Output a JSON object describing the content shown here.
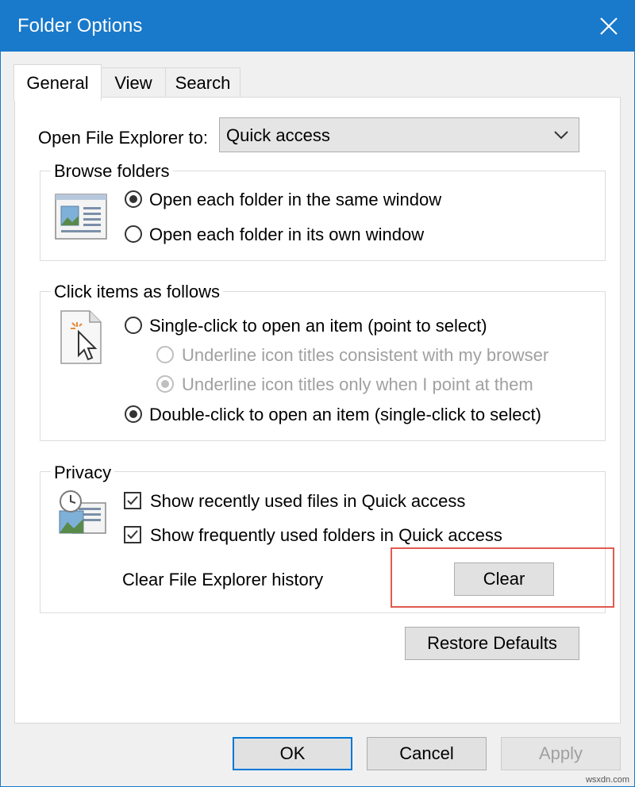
{
  "window": {
    "title": "Folder Options",
    "accent_color": "#1979ca"
  },
  "tabs": [
    {
      "label": "General",
      "active": true
    },
    {
      "label": "View",
      "active": false
    },
    {
      "label": "Search",
      "active": false
    }
  ],
  "open_explorer": {
    "label": "Open File Explorer to:",
    "selected": "Quick access",
    "icon": "chevron-down-icon"
  },
  "browse_folders": {
    "title": "Browse folders",
    "options": [
      {
        "label": "Open each folder in the same window",
        "checked": true
      },
      {
        "label": "Open each folder in its own window",
        "checked": false
      }
    ]
  },
  "click_items": {
    "title": "Click items as follows",
    "options": [
      {
        "label": "Single-click to open an item (point to select)",
        "checked": false,
        "enabled": true
      },
      {
        "label": "Underline icon titles consistent with my browser",
        "checked": false,
        "enabled": false
      },
      {
        "label": "Underline icon titles only when I point at them",
        "checked": true,
        "enabled": false
      },
      {
        "label": "Double-click to open an item (single-click to select)",
        "checked": true,
        "enabled": true
      }
    ]
  },
  "privacy": {
    "title": "Privacy",
    "checkboxes": [
      {
        "label": "Show recently used files in Quick access",
        "checked": true
      },
      {
        "label": "Show frequently used folders in Quick access",
        "checked": true
      }
    ],
    "clear_history_label": "Clear File Explorer history",
    "clear_button": "Clear"
  },
  "restore_defaults": "Restore Defaults",
  "footer": {
    "ok": "OK",
    "cancel": "Cancel",
    "apply": "Apply"
  },
  "highlight_color": "#e05a50",
  "watermark": "wsxdn.com"
}
